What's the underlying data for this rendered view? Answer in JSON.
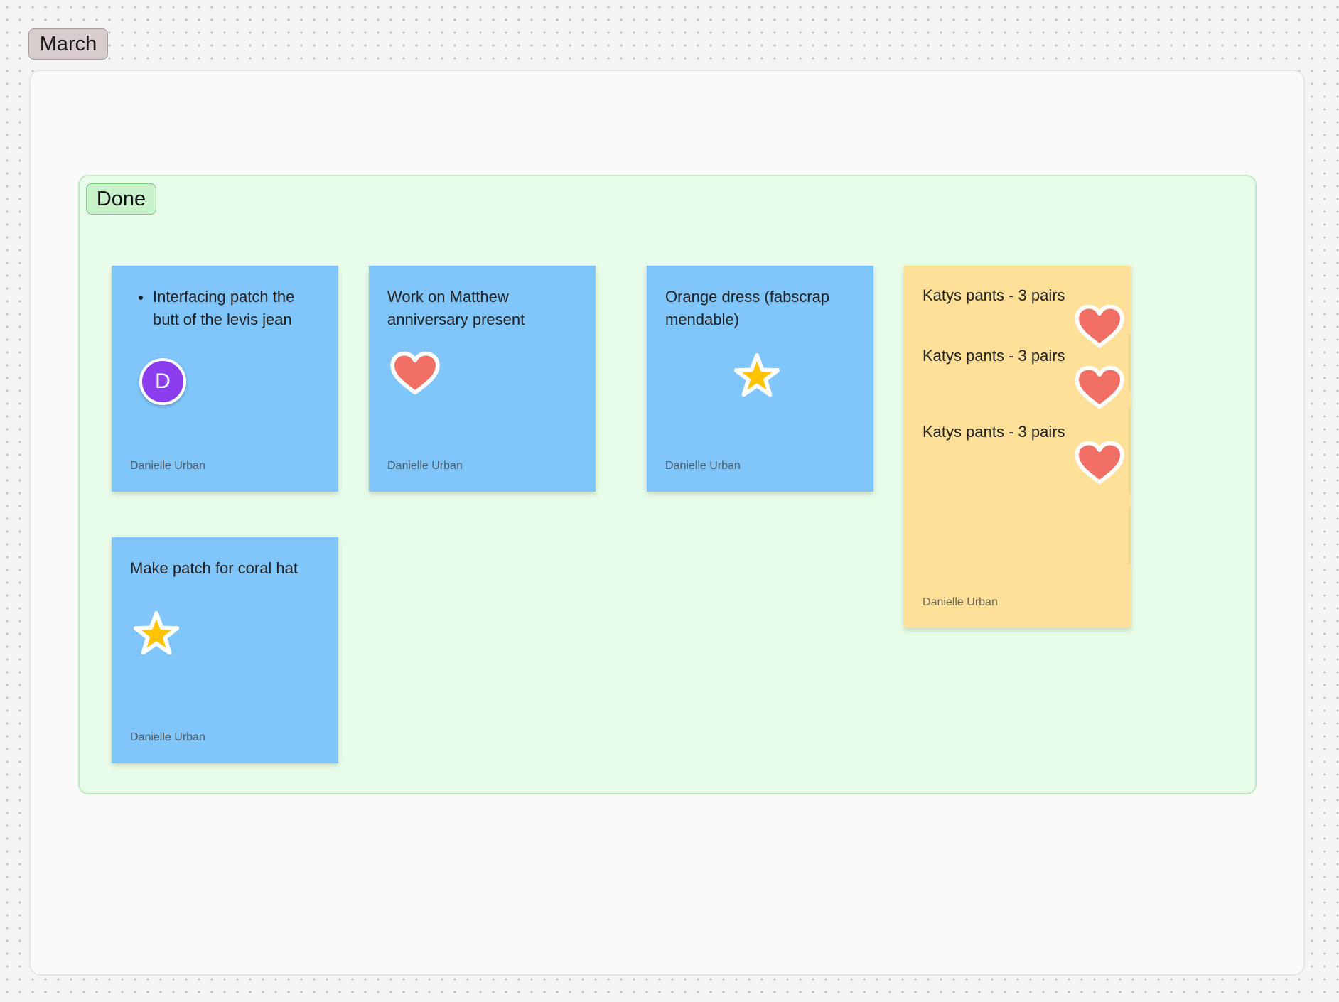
{
  "section": {
    "label": "March",
    "label_color": "#d8cccc"
  },
  "group": {
    "label": "Done",
    "background": "#e7fde9"
  },
  "stickies": [
    {
      "color": "blue",
      "text": "Interfacing patch the butt of the levis jean",
      "bullet": true,
      "sticker": "avatar",
      "avatar_initial": "D",
      "author": "Danielle Urban"
    },
    {
      "color": "blue",
      "text": "Work on Matthew anniversary present",
      "sticker": "heart-icon",
      "author": "Danielle Urban"
    },
    {
      "color": "blue",
      "text": "Orange dress (fabscrap mendable)",
      "sticker": "star-icon",
      "author": "Danielle Urban"
    },
    {
      "color": "blue",
      "text": "Make patch for coral hat",
      "sticker": "star-icon",
      "author": "Danielle Urban"
    }
  ],
  "stack": {
    "color": "yellow",
    "items": [
      {
        "text": "Katys pants - 3 pairs",
        "sticker": "heart-icon"
      },
      {
        "text": "Katys pants - 3 pairs",
        "sticker": "heart-icon"
      },
      {
        "text": "Katys pants - 3 pairs",
        "sticker": "heart-icon"
      }
    ],
    "author": "Danielle Urban"
  },
  "colors": {
    "sticky_blue": "#80c6fb",
    "sticky_yellow": "#ffe099",
    "heart": "#f26f66",
    "star": "#ffc300",
    "avatar": "#8b3ded"
  }
}
